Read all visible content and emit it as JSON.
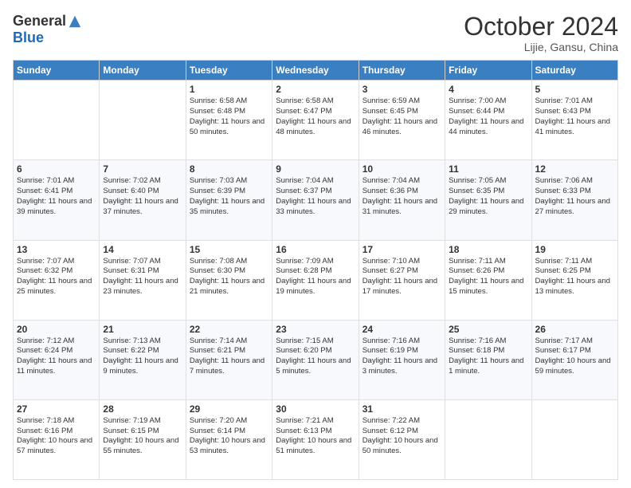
{
  "logo": {
    "general": "General",
    "blue": "Blue"
  },
  "title": "October 2024",
  "location": "Lijie, Gansu, China",
  "days": [
    "Sunday",
    "Monday",
    "Tuesday",
    "Wednesday",
    "Thursday",
    "Friday",
    "Saturday"
  ],
  "weeks": [
    [
      {
        "day": "",
        "sunrise": "",
        "sunset": "",
        "daylight": ""
      },
      {
        "day": "",
        "sunrise": "",
        "sunset": "",
        "daylight": ""
      },
      {
        "day": "1",
        "sunrise": "Sunrise: 6:58 AM",
        "sunset": "Sunset: 6:48 PM",
        "daylight": "Daylight: 11 hours and 50 minutes."
      },
      {
        "day": "2",
        "sunrise": "Sunrise: 6:58 AM",
        "sunset": "Sunset: 6:47 PM",
        "daylight": "Daylight: 11 hours and 48 minutes."
      },
      {
        "day": "3",
        "sunrise": "Sunrise: 6:59 AM",
        "sunset": "Sunset: 6:45 PM",
        "daylight": "Daylight: 11 hours and 46 minutes."
      },
      {
        "day": "4",
        "sunrise": "Sunrise: 7:00 AM",
        "sunset": "Sunset: 6:44 PM",
        "daylight": "Daylight: 11 hours and 44 minutes."
      },
      {
        "day": "5",
        "sunrise": "Sunrise: 7:01 AM",
        "sunset": "Sunset: 6:43 PM",
        "daylight": "Daylight: 11 hours and 41 minutes."
      }
    ],
    [
      {
        "day": "6",
        "sunrise": "Sunrise: 7:01 AM",
        "sunset": "Sunset: 6:41 PM",
        "daylight": "Daylight: 11 hours and 39 minutes."
      },
      {
        "day": "7",
        "sunrise": "Sunrise: 7:02 AM",
        "sunset": "Sunset: 6:40 PM",
        "daylight": "Daylight: 11 hours and 37 minutes."
      },
      {
        "day": "8",
        "sunrise": "Sunrise: 7:03 AM",
        "sunset": "Sunset: 6:39 PM",
        "daylight": "Daylight: 11 hours and 35 minutes."
      },
      {
        "day": "9",
        "sunrise": "Sunrise: 7:04 AM",
        "sunset": "Sunset: 6:37 PM",
        "daylight": "Daylight: 11 hours and 33 minutes."
      },
      {
        "day": "10",
        "sunrise": "Sunrise: 7:04 AM",
        "sunset": "Sunset: 6:36 PM",
        "daylight": "Daylight: 11 hours and 31 minutes."
      },
      {
        "day": "11",
        "sunrise": "Sunrise: 7:05 AM",
        "sunset": "Sunset: 6:35 PM",
        "daylight": "Daylight: 11 hours and 29 minutes."
      },
      {
        "day": "12",
        "sunrise": "Sunrise: 7:06 AM",
        "sunset": "Sunset: 6:33 PM",
        "daylight": "Daylight: 11 hours and 27 minutes."
      }
    ],
    [
      {
        "day": "13",
        "sunrise": "Sunrise: 7:07 AM",
        "sunset": "Sunset: 6:32 PM",
        "daylight": "Daylight: 11 hours and 25 minutes."
      },
      {
        "day": "14",
        "sunrise": "Sunrise: 7:07 AM",
        "sunset": "Sunset: 6:31 PM",
        "daylight": "Daylight: 11 hours and 23 minutes."
      },
      {
        "day": "15",
        "sunrise": "Sunrise: 7:08 AM",
        "sunset": "Sunset: 6:30 PM",
        "daylight": "Daylight: 11 hours and 21 minutes."
      },
      {
        "day": "16",
        "sunrise": "Sunrise: 7:09 AM",
        "sunset": "Sunset: 6:28 PM",
        "daylight": "Daylight: 11 hours and 19 minutes."
      },
      {
        "day": "17",
        "sunrise": "Sunrise: 7:10 AM",
        "sunset": "Sunset: 6:27 PM",
        "daylight": "Daylight: 11 hours and 17 minutes."
      },
      {
        "day": "18",
        "sunrise": "Sunrise: 7:11 AM",
        "sunset": "Sunset: 6:26 PM",
        "daylight": "Daylight: 11 hours and 15 minutes."
      },
      {
        "day": "19",
        "sunrise": "Sunrise: 7:11 AM",
        "sunset": "Sunset: 6:25 PM",
        "daylight": "Daylight: 11 hours and 13 minutes."
      }
    ],
    [
      {
        "day": "20",
        "sunrise": "Sunrise: 7:12 AM",
        "sunset": "Sunset: 6:24 PM",
        "daylight": "Daylight: 11 hours and 11 minutes."
      },
      {
        "day": "21",
        "sunrise": "Sunrise: 7:13 AM",
        "sunset": "Sunset: 6:22 PM",
        "daylight": "Daylight: 11 hours and 9 minutes."
      },
      {
        "day": "22",
        "sunrise": "Sunrise: 7:14 AM",
        "sunset": "Sunset: 6:21 PM",
        "daylight": "Daylight: 11 hours and 7 minutes."
      },
      {
        "day": "23",
        "sunrise": "Sunrise: 7:15 AM",
        "sunset": "Sunset: 6:20 PM",
        "daylight": "Daylight: 11 hours and 5 minutes."
      },
      {
        "day": "24",
        "sunrise": "Sunrise: 7:16 AM",
        "sunset": "Sunset: 6:19 PM",
        "daylight": "Daylight: 11 hours and 3 minutes."
      },
      {
        "day": "25",
        "sunrise": "Sunrise: 7:16 AM",
        "sunset": "Sunset: 6:18 PM",
        "daylight": "Daylight: 11 hours and 1 minute."
      },
      {
        "day": "26",
        "sunrise": "Sunrise: 7:17 AM",
        "sunset": "Sunset: 6:17 PM",
        "daylight": "Daylight: 10 hours and 59 minutes."
      }
    ],
    [
      {
        "day": "27",
        "sunrise": "Sunrise: 7:18 AM",
        "sunset": "Sunset: 6:16 PM",
        "daylight": "Daylight: 10 hours and 57 minutes."
      },
      {
        "day": "28",
        "sunrise": "Sunrise: 7:19 AM",
        "sunset": "Sunset: 6:15 PM",
        "daylight": "Daylight: 10 hours and 55 minutes."
      },
      {
        "day": "29",
        "sunrise": "Sunrise: 7:20 AM",
        "sunset": "Sunset: 6:14 PM",
        "daylight": "Daylight: 10 hours and 53 minutes."
      },
      {
        "day": "30",
        "sunrise": "Sunrise: 7:21 AM",
        "sunset": "Sunset: 6:13 PM",
        "daylight": "Daylight: 10 hours and 51 minutes."
      },
      {
        "day": "31",
        "sunrise": "Sunrise: 7:22 AM",
        "sunset": "Sunset: 6:12 PM",
        "daylight": "Daylight: 10 hours and 50 minutes."
      },
      {
        "day": "",
        "sunrise": "",
        "sunset": "",
        "daylight": ""
      },
      {
        "day": "",
        "sunrise": "",
        "sunset": "",
        "daylight": ""
      }
    ]
  ]
}
